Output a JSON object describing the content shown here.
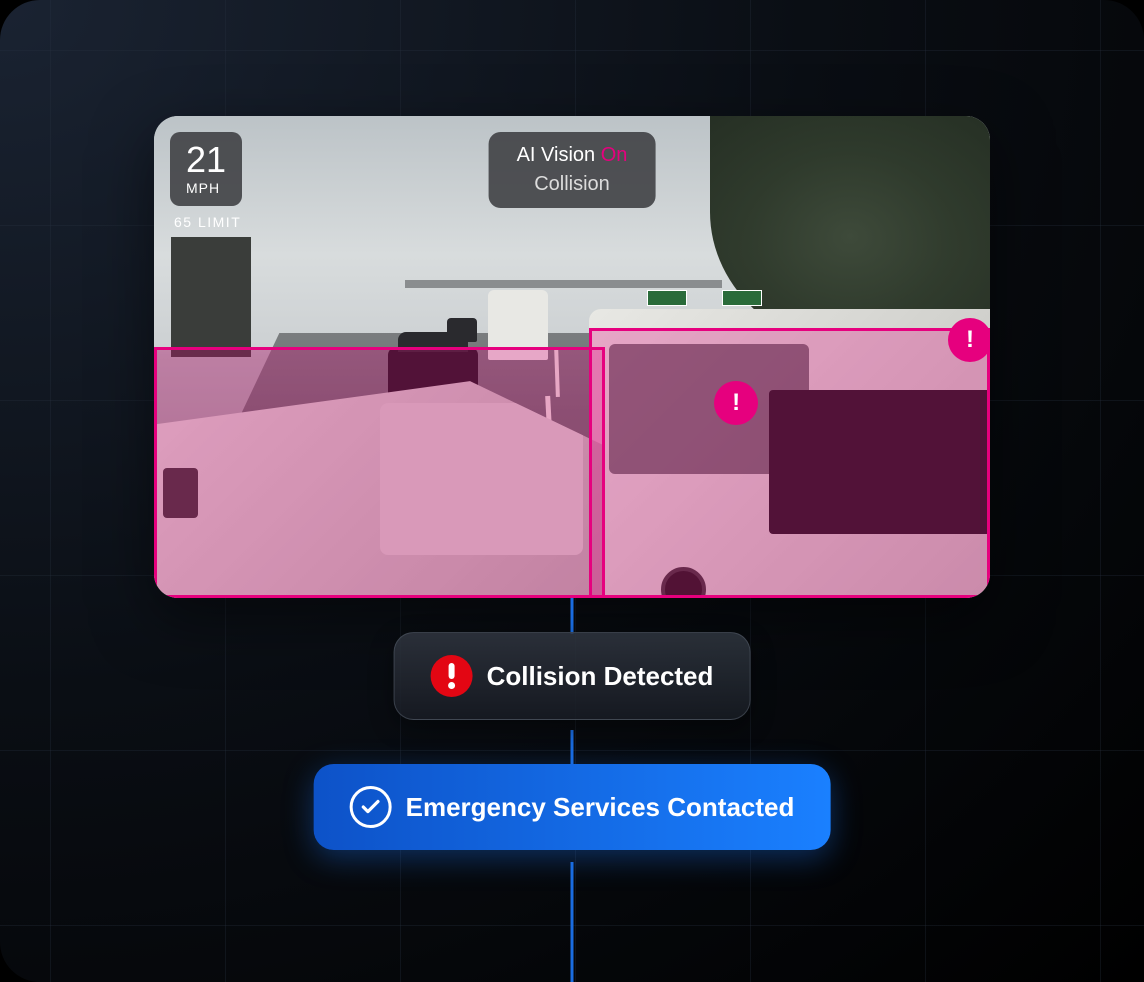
{
  "speed": {
    "value": "21",
    "unit": "MPH",
    "limit": "65 LIMIT"
  },
  "ai_vision": {
    "label": "AI Vision",
    "status": "On",
    "event": "Collision"
  },
  "warning_marker": "!",
  "badges": {
    "collision": {
      "label": "Collision Detected"
    },
    "emergency": {
      "label": "Emergency Services Contacted"
    }
  },
  "colors": {
    "detection": "#e6007e",
    "alert": "#e30613",
    "primary": "#1a6ce0"
  }
}
